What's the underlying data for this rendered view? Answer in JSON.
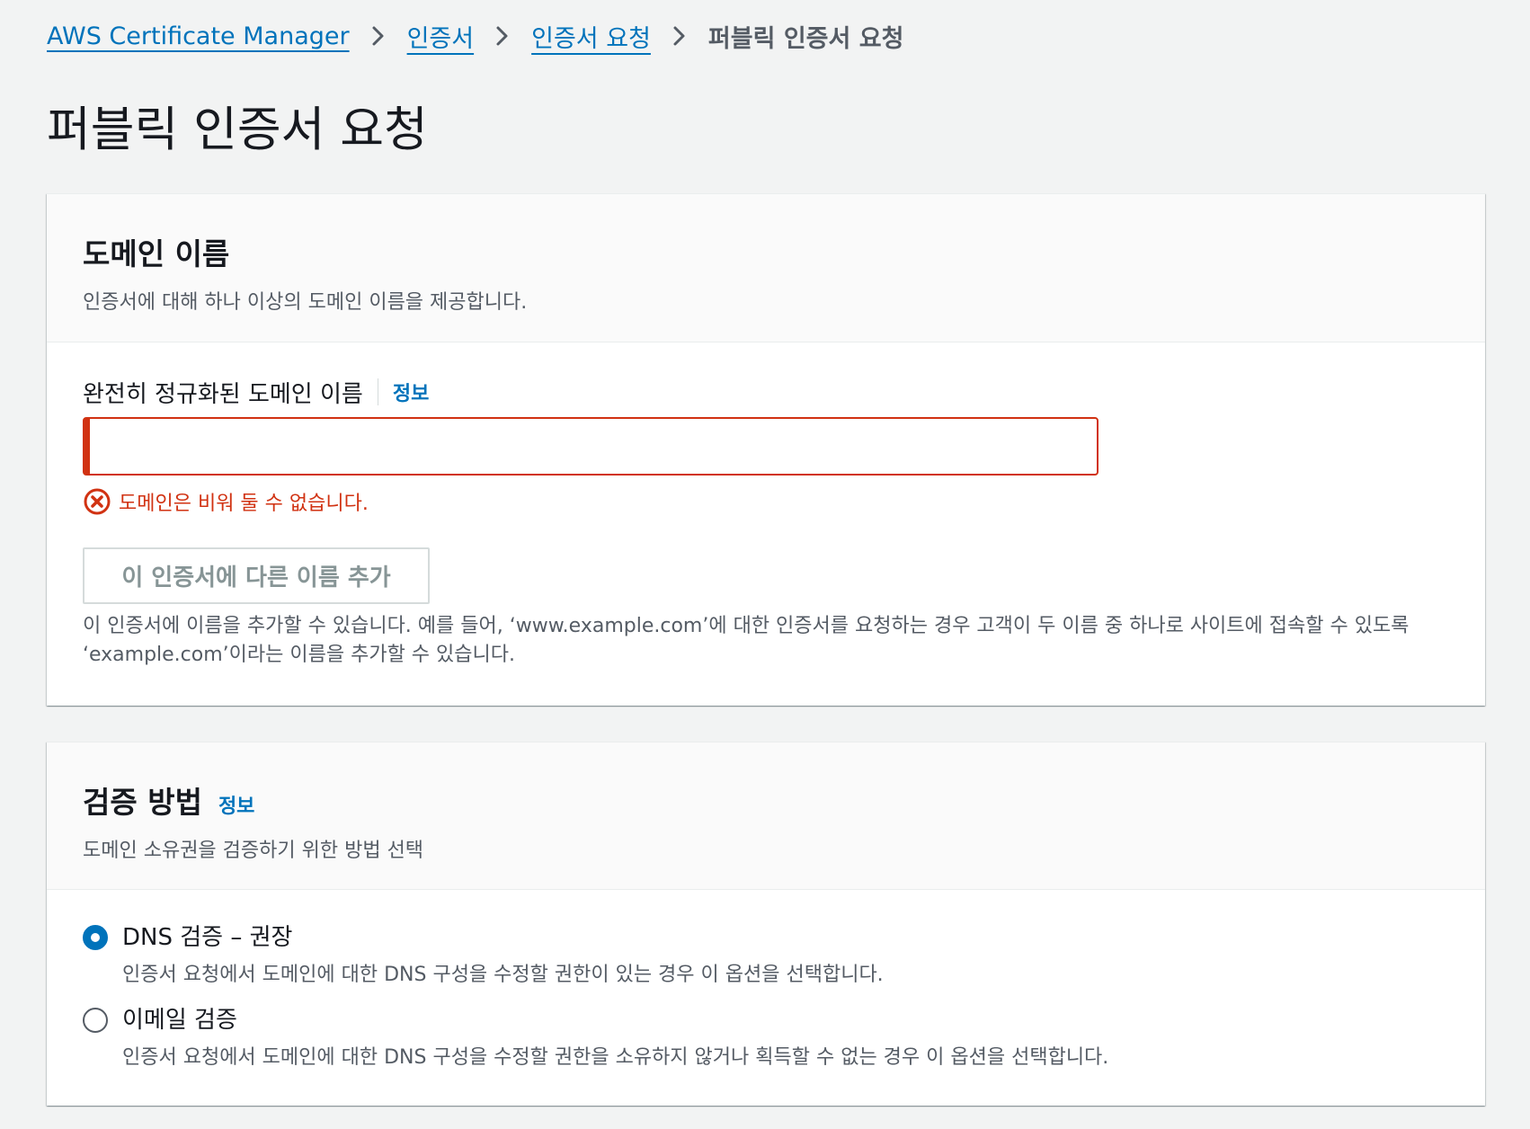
{
  "breadcrumb": {
    "items": [
      {
        "label": "AWS Certificate Manager"
      },
      {
        "label": "인증서"
      },
      {
        "label": "인증서 요청"
      }
    ],
    "current": "퍼블릭 인증서 요청"
  },
  "page": {
    "title": "퍼블릭 인증서 요청"
  },
  "domain_panel": {
    "title": "도메인 이름",
    "description": "인증서에 대해 하나 이상의 도메인 이름을 제공합니다.",
    "field_label": "완전히 정규화된 도메인 이름",
    "info_link": "정보",
    "input_value": "",
    "error_text": "도메인은 비워 둘 수 없습니다.",
    "add_button_label": "이 인증서에 다른 이름 추가",
    "help_text": "이 인증서에 이름을 추가할 수 있습니다. 예를 들어, ‘www.example.com’에 대한 인증서를 요청하는 경우 고객이 두 이름 중 하나로 사이트에 접속할 수 있도록 ‘example.com’이라는 이름을 추가할 수 있습니다."
  },
  "validation_panel": {
    "title": "검증 방법",
    "info_link": "정보",
    "description": "도메인 소유권을 검증하기 위한 방법 선택",
    "options": [
      {
        "label": "DNS 검증 – 권장",
        "description": "인증서 요청에서 도메인에 대한 DNS 구성을 수정할 권한이 있는 경우 이 옵션을 선택합니다.",
        "selected": true
      },
      {
        "label": "이메일 검증",
        "description": "인증서 요청에서 도메인에 대한 DNS 구성을 수정할 권한을 소유하지 않거나 획득할 수 없는 경우 이 옵션을 선택합니다.",
        "selected": false
      }
    ]
  },
  "colors": {
    "link": "#0073bb",
    "error": "#d13212",
    "background": "#f2f3f3",
    "text_secondary": "#545b64"
  },
  "icons": {
    "breadcrumb_separator": "chevron-right-icon",
    "error": "error-circle-icon"
  }
}
